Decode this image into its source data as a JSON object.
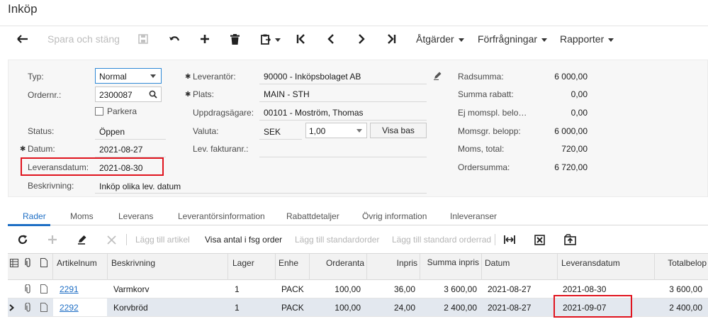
{
  "page": {
    "title": "Inköp"
  },
  "toolbar": {
    "save_close": "Spara och stäng",
    "actions": "Åtgärder",
    "inquiries": "Förfrågningar",
    "reports": "Rapporter"
  },
  "form": {
    "typ": {
      "label": "Typ:",
      "value": "Normal"
    },
    "ordernr": {
      "label": "Ordernr.:",
      "value": "2300087"
    },
    "parkera": {
      "label": "Parkera",
      "checked": false
    },
    "status": {
      "label": "Status:",
      "value": "Öppen"
    },
    "datum": {
      "label": "Datum:",
      "value": "2021-08-27"
    },
    "leveransdatum": {
      "label": "Leveransdatum:",
      "value": "2021-08-30"
    },
    "beskrivning": {
      "label": "Beskrivning:",
      "value": "Inköp olika lev. datum"
    },
    "leverantor": {
      "label": "Leverantör:",
      "value": "90000 - Inköpsbolaget AB"
    },
    "plats": {
      "label": "Plats:",
      "value": "MAIN - STH"
    },
    "uppdragsagare": {
      "label": "Uppdragsägare:",
      "value": "00101 - Moström, Thomas"
    },
    "valuta": {
      "label": "Valuta:",
      "currency": "SEK",
      "rate": "1,00",
      "view_base": "Visa bas"
    },
    "levfakturanr": {
      "label": "Lev. fakturanr.:",
      "value": ""
    },
    "totals": [
      {
        "label": "Radsumma:",
        "value": "6 000,00"
      },
      {
        "label": "Summa rabatt:",
        "value": "0,00"
      },
      {
        "label": "Ej momspl. belo…",
        "value": "0,00"
      },
      {
        "label": "Momsgr. belopp:",
        "value": "6 000,00"
      },
      {
        "label": "Moms, total:",
        "value": "720,00"
      },
      {
        "label": "Ordersumma:",
        "value": "6 720,00"
      }
    ]
  },
  "tabs": [
    "Rader",
    "Moms",
    "Leverans",
    "Leverantörsinformation",
    "Rabattdetaljer",
    "Övrig information",
    "Inleveranser"
  ],
  "gridbar": {
    "add_item": "Lägg till artikel",
    "show_qty": "Visa antal i fsg order",
    "add_std_order": "Lägg till standardorder",
    "add_std_row": "Lägg till standard orderrad"
  },
  "grid": {
    "columns": [
      "Artikelnum",
      "Beskrivning",
      "Lager",
      "Enhe",
      "Orderanta",
      "Inpris",
      "Summa inpris",
      "Datum",
      "Leveransdatum",
      "Totalbelop"
    ],
    "rows": [
      [
        "2291",
        "Varmkorv",
        "1",
        "PACK",
        "100,00",
        "36,00",
        "3 600,00",
        "2021-08-27",
        "2021-08-30",
        "3 600,00"
      ],
      [
        "2292",
        "Korvbröd",
        "1",
        "PACK",
        "100,00",
        "24,00",
        "2 400,00",
        "2021-08-27",
        "2021-09-07",
        "2 400,00"
      ]
    ]
  },
  "colors": {
    "accent": "#1f6fc5",
    "highlight": "#e0141e"
  }
}
